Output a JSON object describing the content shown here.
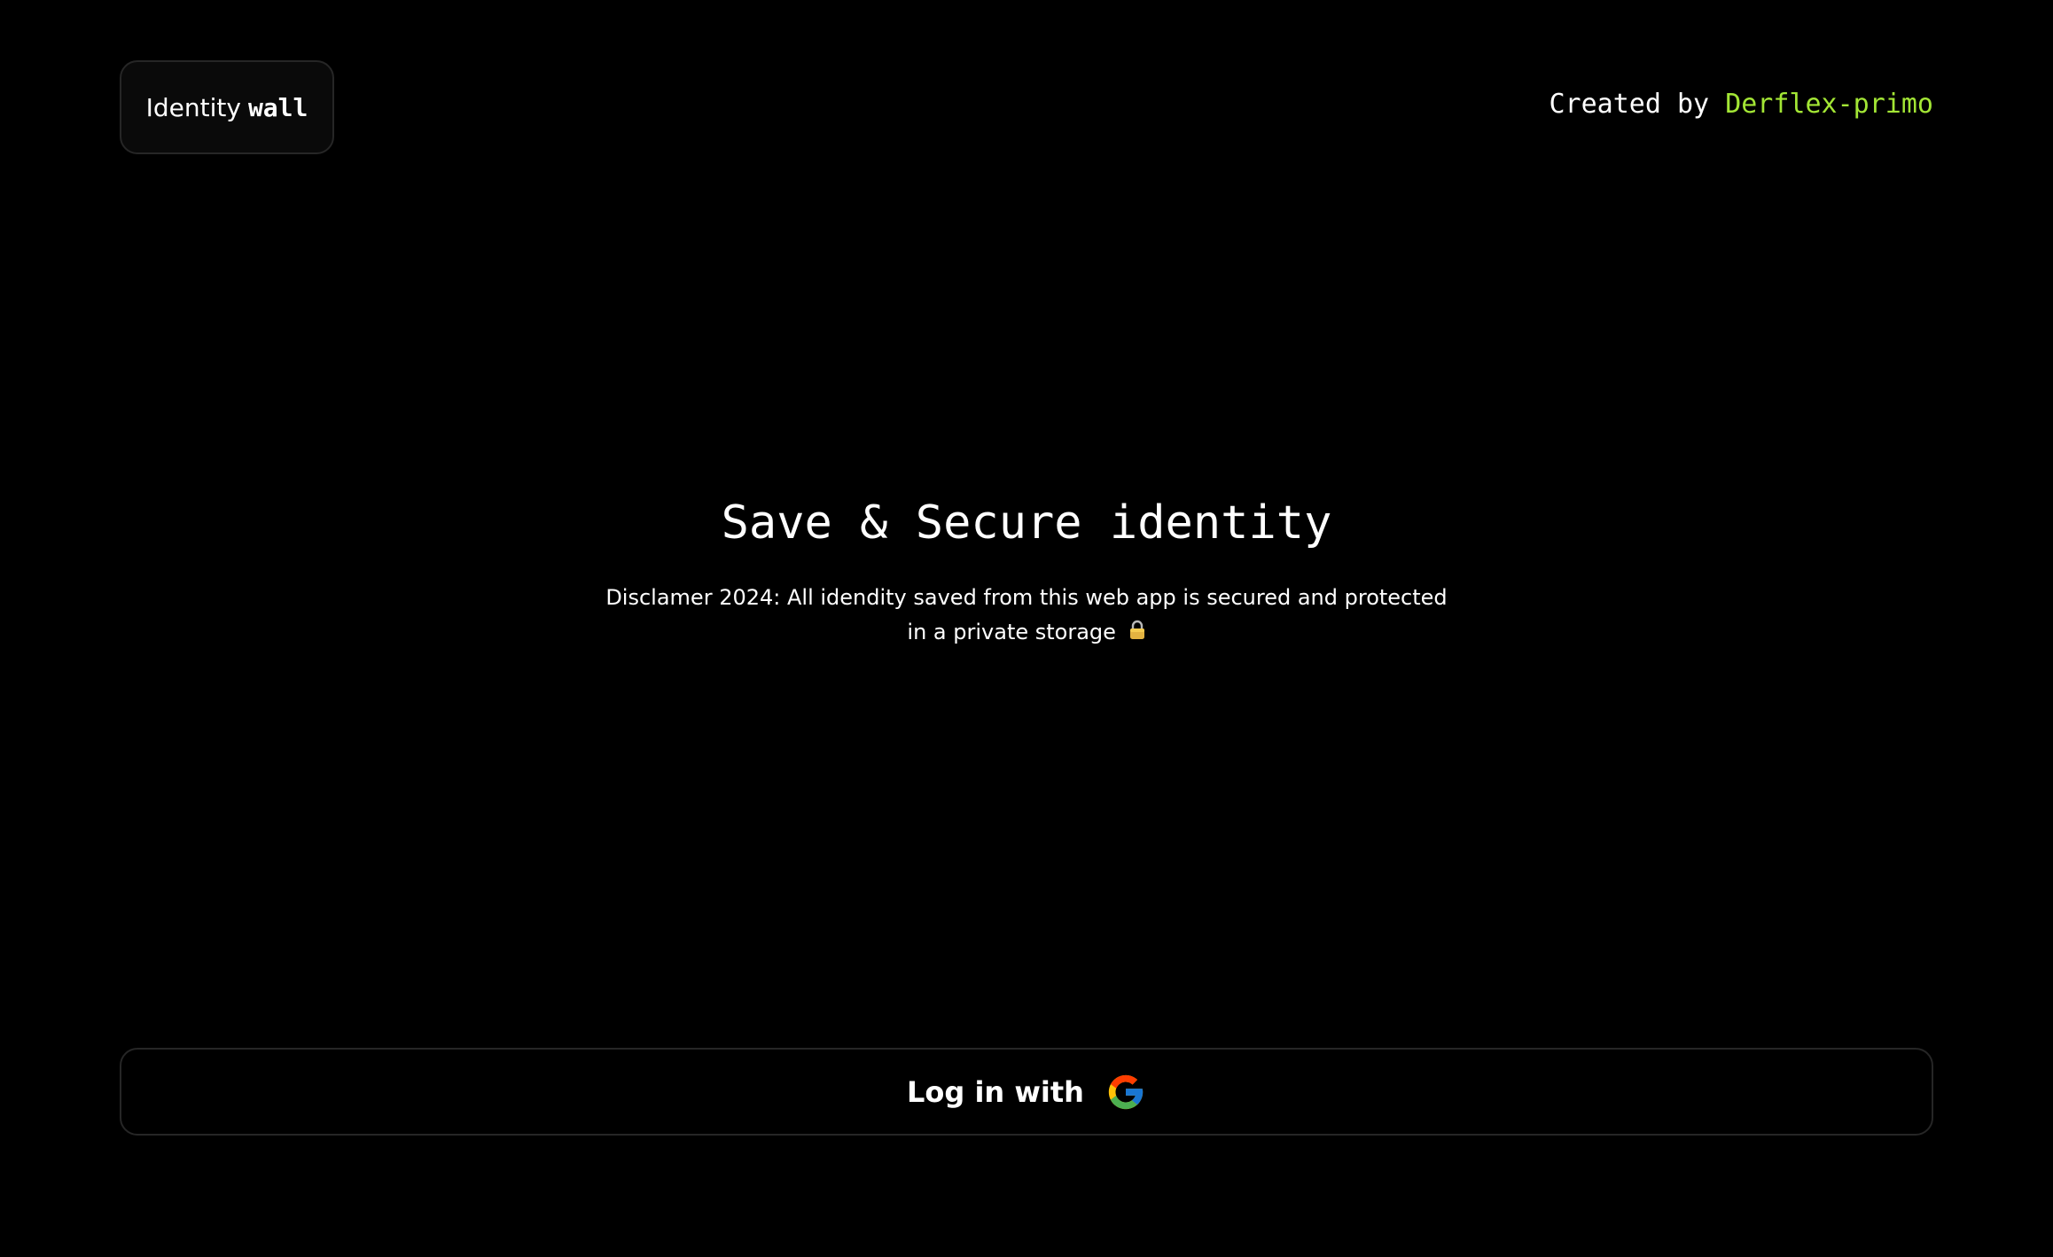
{
  "header": {
    "logo_word1": "Identity",
    "logo_word2": "wall",
    "credit_prefix": "Created by",
    "credit_author": "Derflex-primo"
  },
  "hero": {
    "title": "Save & Secure identity",
    "disclaimer_line1": "Disclamer 2024: All idendity saved from this web app is secured and protected",
    "disclaimer_line2": "in a private storage"
  },
  "login": {
    "label": "Log in with",
    "provider_icon": "google-icon"
  },
  "icons": {
    "lock": "lock-icon"
  },
  "colors": {
    "background": "#000000",
    "accent": "#a3e635",
    "border": "#262626",
    "text": "#ffffff"
  }
}
